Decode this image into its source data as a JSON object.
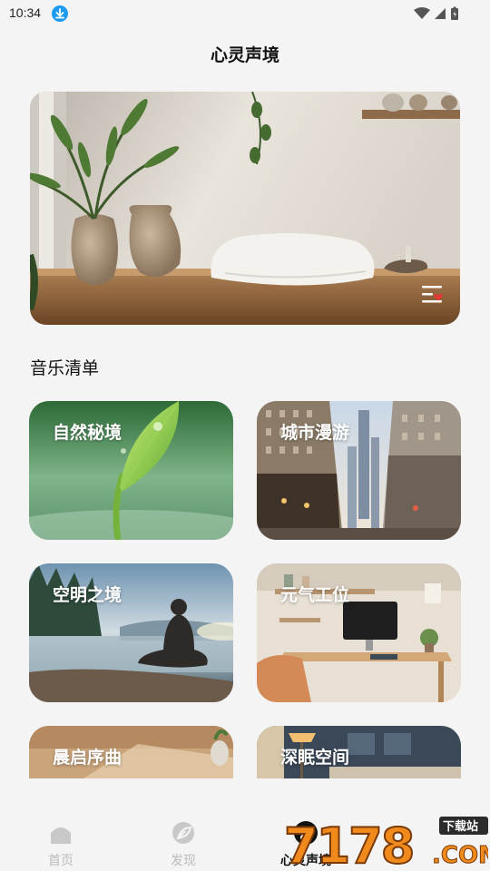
{
  "status_bar": {
    "time": "10:34"
  },
  "header": {
    "title": "心灵声境"
  },
  "section": {
    "title": "音乐清单"
  },
  "cards": [
    {
      "label": "自然秘境"
    },
    {
      "label": "城市漫游"
    },
    {
      "label": "空明之境"
    },
    {
      "label": "元气工位"
    },
    {
      "label": "晨启序曲"
    },
    {
      "label": "深眠空间"
    }
  ],
  "tabs": [
    {
      "label": "首页",
      "icon": "home-icon",
      "active": false
    },
    {
      "label": "发现",
      "icon": "leaf-icon",
      "active": false
    },
    {
      "label": "心灵声境",
      "icon": "music-note-icon",
      "active": true
    }
  ],
  "watermark": {
    "text": "7178",
    "sub": "下载站",
    "domain": ".COM"
  },
  "colors": {
    "accent": "#1e9bf0",
    "heart": "#e53935",
    "active_tab": "#111111",
    "inactive_tab": "#bbbbbb"
  }
}
